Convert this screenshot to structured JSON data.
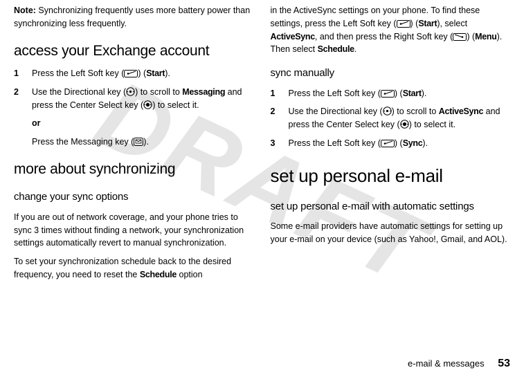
{
  "watermark": "DRAFT",
  "left": {
    "note_label": "Note:",
    "note_text": " Synchronizing frequently uses more battery power than synchronizing less frequently.",
    "h2_access": "access your Exchange account",
    "step1_num": "1",
    "step1_a": "Press the Left Soft key (",
    "step1_b": ") (",
    "step1_start": "Start",
    "step1_c": ").",
    "step2_num": "2",
    "step2_a": "Use the Directional key (",
    "step2_b": ") to scroll to ",
    "step2_messaging": "Messaging",
    "step2_c": " and press the Center Select key (",
    "step2_d": ") to select it.",
    "or": "or",
    "step2_alt_a": "Press the Messaging key (",
    "step2_alt_b": ").",
    "h2_more": "more about synchronizing",
    "h3_change": "change your sync options",
    "para1": "If you are out of network coverage, and your phone tries to sync 3 times without finding a network, your synchronization settings automatically revert to manual synchronization.",
    "para2_a": "To set your synchronization schedule back to the desired frequency, you need to reset the ",
    "para2_schedule": "Schedule",
    "para2_b": " option"
  },
  "right": {
    "cont_a": "in the ActiveSync settings on your phone. To find these settings, press the Left Soft key (",
    "cont_b": ") (",
    "cont_start": "Start",
    "cont_c": "), select ",
    "cont_activesync": "ActiveSync",
    "cont_d": ", and then press the Right Soft key (",
    "cont_e": ") (",
    "cont_menu": "Menu",
    "cont_f": "). Then select ",
    "cont_schedule": "Schedule",
    "cont_g": ".",
    "h3_sync": "sync manually",
    "step1_num": "1",
    "step1_a": "Press the Left Soft key (",
    "step1_b": ") (",
    "step1_start": "Start",
    "step1_c": ").",
    "step2_num": "2",
    "step2_a": "Use the Directional key (",
    "step2_b": ") to scroll to ",
    "step2_activesync": "ActiveSync",
    "step2_c": " and press the Center Select key (",
    "step2_d": ") to select it.",
    "step3_num": "3",
    "step3_a": "Press the Left Soft key (",
    "step3_b": ") (",
    "step3_sync": "Sync",
    "step3_c": ").",
    "h1_personal": "set up personal e-mail",
    "h3_auto": "set up personal e-mail with automatic settings",
    "para_auto": "Some e-mail providers have automatic settings for setting up your e-mail on your device (such as Yahoo!, Gmail, and AOL)."
  },
  "footer": {
    "section": "e-mail & messages",
    "page": "53"
  }
}
